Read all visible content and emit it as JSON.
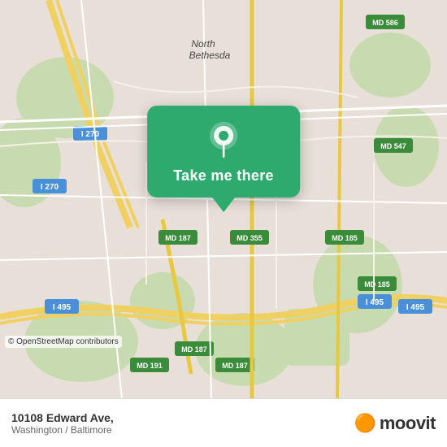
{
  "map": {
    "osm_credit": "© OpenStreetMap contributors"
  },
  "cta": {
    "button_label": "Take me there"
  },
  "footer": {
    "address_main": "10108 Edward Ave,",
    "address_sub": "Washington / Baltimore",
    "logo_text": "moovit",
    "logo_icon": "🟠"
  }
}
